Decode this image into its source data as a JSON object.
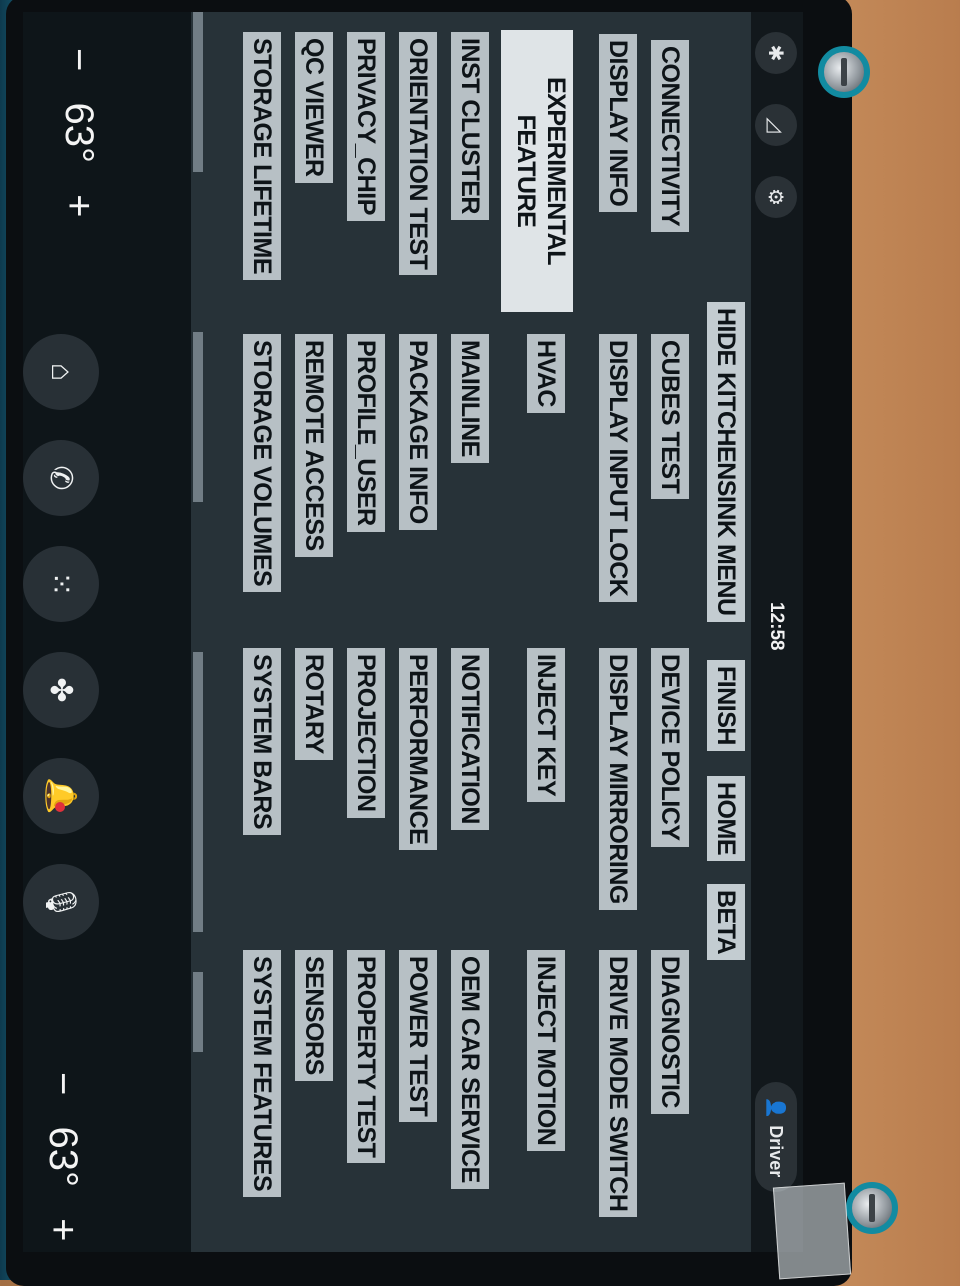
{
  "status_bar": {
    "clock": "12:58",
    "profile_label": "Driver",
    "icons": [
      "bluetooth-icon",
      "signal-icon",
      "settings-icon"
    ]
  },
  "kitchensink": {
    "top_buttons": [
      "HIDE KITCHENSINK MENU",
      "FINISH",
      "HOME",
      "BETA"
    ],
    "sidebar_items": [
      "CONNECTIVITY",
      "DISPLAY INFO",
      "EXPERIMENTAL FEATURE",
      "INST CLUSTER",
      "ORIENTATION TEST",
      "PRIVACY_CHIP",
      "QC VIEWER",
      "STORAGE LIFETIME"
    ],
    "selected_item": "EXPERIMENTAL FEATURE",
    "column1": [
      "CUBES TEST",
      "DISPLAY INPUT LOCK",
      "HVAC",
      "MAINLINE",
      "PACKAGE INFO",
      "PROFILE_USER",
      "REMOTE ACCESS",
      "STORAGE VOLUMES"
    ],
    "column2": [
      "DEVICE POLICY",
      "DISPLAY MIRRORING",
      "INJECT KEY",
      "NOTIFICATION",
      "PERFORMANCE",
      "PROJECTION",
      "ROTARY",
      "SYSTEM BARS"
    ],
    "column3": [
      "DIAGNOSTIC",
      "DRIVE MODE SWITCH",
      "INJECT MOTION",
      "OEM CAR SERVICE",
      "POWER TEST",
      "PROPERTY TEST",
      "SENSORS",
      "SYSTEM FEATURES"
    ]
  },
  "navbar": {
    "driver_temp": {
      "minus": "−",
      "value": "63°",
      "plus": "+"
    },
    "passenger_temp": {
      "minus": "−",
      "value": "63°",
      "plus": "+"
    },
    "buttons": [
      "home-icon",
      "phone-icon",
      "app-grid-icon",
      "fan-icon",
      "notification-bell-icon",
      "microphone-icon"
    ]
  }
}
